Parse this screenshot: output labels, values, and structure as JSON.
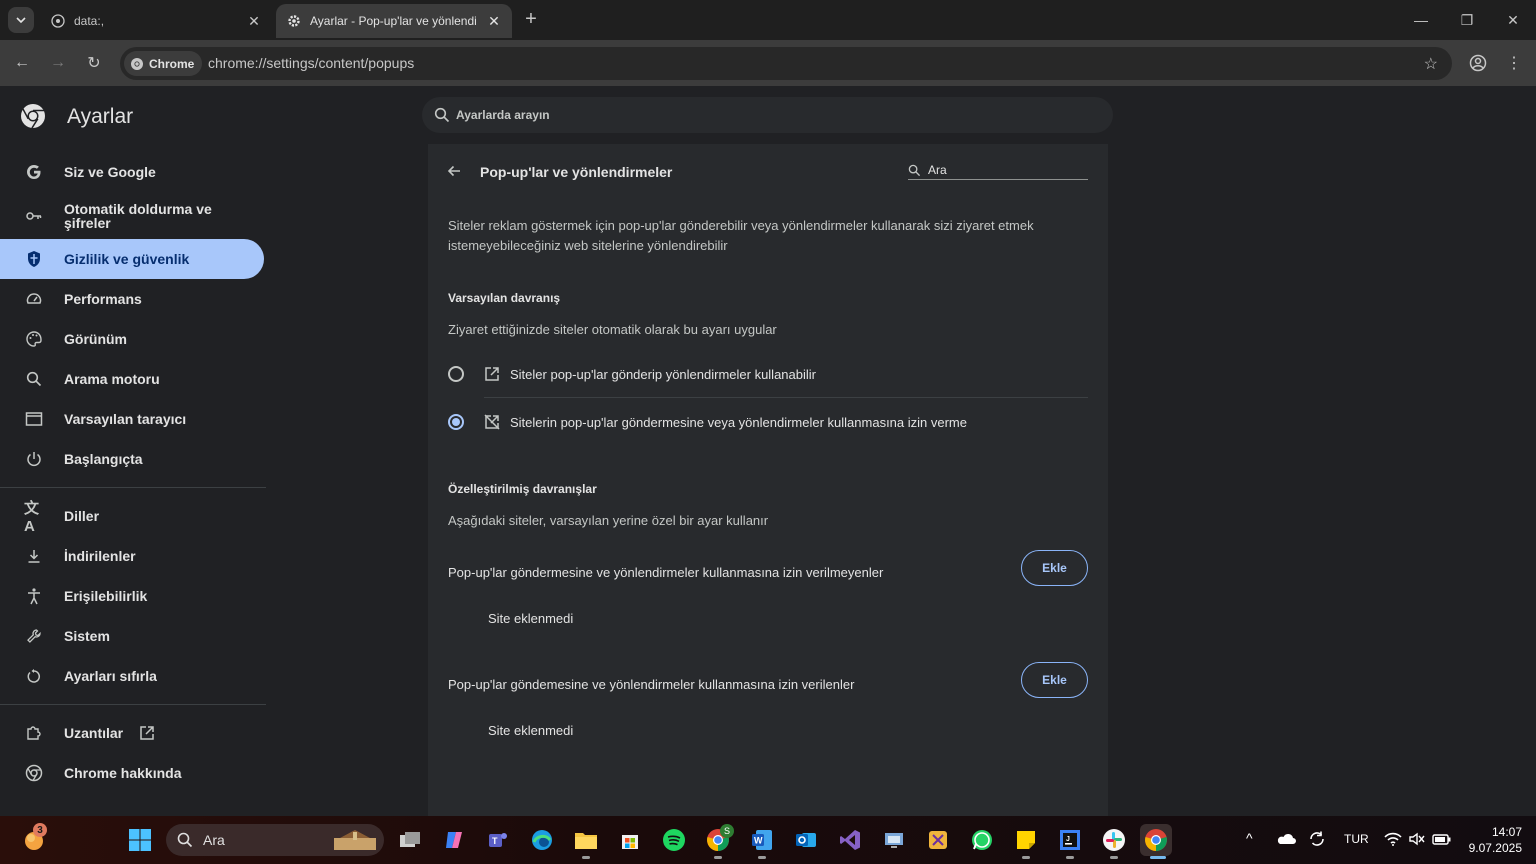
{
  "tabs": [
    {
      "title": "data:,"
    },
    {
      "title": "Ayarlar - Pop-up'lar ve yönlendi"
    }
  ],
  "toolbar": {
    "chip_label": "Chrome",
    "url": "chrome://settings/content/popups"
  },
  "header": {
    "title": "Ayarlar",
    "search_placeholder": "Ayarlarda arayın"
  },
  "sidebar": {
    "items": [
      {
        "label": "Siz ve Google",
        "icon": "google-icon"
      },
      {
        "label": "Otomatik doldurma ve şifreler",
        "icon": "key-icon"
      },
      {
        "label": "Gizlilik ve güvenlik",
        "icon": "shield-icon",
        "active": true
      },
      {
        "label": "Performans",
        "icon": "speedometer-icon"
      },
      {
        "label": "Görünüm",
        "icon": "palette-icon"
      },
      {
        "label": "Arama motoru",
        "icon": "search-icon"
      },
      {
        "label": "Varsayılan tarayıcı",
        "icon": "browser-window-icon"
      },
      {
        "label": "Başlangıçta",
        "icon": "power-icon"
      },
      {
        "label": "Diller",
        "icon": "translate-icon"
      },
      {
        "label": "İndirilenler",
        "icon": "download-icon"
      },
      {
        "label": "Erişilebilirlik",
        "icon": "accessibility-icon"
      },
      {
        "label": "Sistem",
        "icon": "wrench-icon"
      },
      {
        "label": "Ayarları sıfırla",
        "icon": "reset-icon"
      },
      {
        "label": "Uzantılar",
        "icon": "puzzle-icon"
      },
      {
        "label": "Chrome hakkında",
        "icon": "chrome-icon"
      }
    ]
  },
  "main": {
    "title": "Pop-up'lar ve yönlendirmeler",
    "search_placeholder": "Ara",
    "description": "Siteler reklam göstermek için pop-up'lar gönderebilir veya yönlendirmeler kullanarak sizi ziyaret etmek istemeyebileceğiniz web sitelerine yönlendirebilir",
    "default_heading": "Varsayılan davranış",
    "default_sub": "Ziyaret ettiğinizde siteler otomatik olarak bu ayarı uygular",
    "options": [
      {
        "label": "Siteler pop-up'lar gönderip yönlendirmeler kullanabilir",
        "checked": false
      },
      {
        "label": "Sitelerin pop-up'lar göndermesine veya yönlendirmeler kullanmasına izin verme",
        "checked": true
      }
    ],
    "custom_heading": "Özelleştirilmiş davranışlar",
    "custom_sub": "Aşağıdaki siteler, varsayılan yerine özel bir ayar kullanır",
    "blocked_label": "Pop-up'lar göndermesine ve yönlendirmeler kullanmasına izin verilmeyenler",
    "allowed_label": "Pop-up'lar göndemesine ve yönlendirmeler kullanmasına izin verilenler",
    "add_label": "Ekle",
    "empty_label": "Site eklenmedi"
  },
  "taskbar": {
    "search_label": "Ara",
    "notification_count": "3",
    "chrome_badge": "S",
    "language": "TUR",
    "time": "14:07",
    "date": "9.07.2025"
  }
}
